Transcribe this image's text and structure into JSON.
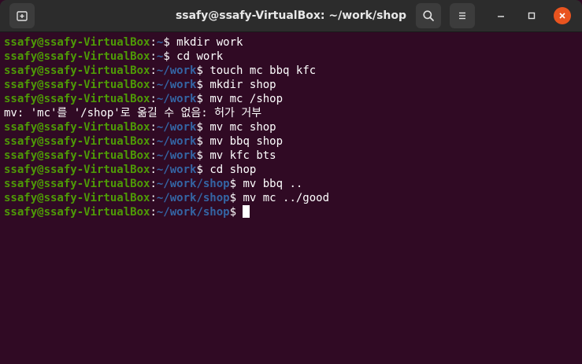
{
  "window": {
    "title": "ssafy@ssafy-VirtualBox: ~/work/shop"
  },
  "icons": {
    "new_tab": "new-tab-icon",
    "search": "search-icon",
    "menu": "hamburger-menu-icon",
    "minimize": "minimize-icon",
    "maximize": "maximize-icon",
    "close": "close-icon"
  },
  "colors": {
    "background": "#300a24",
    "user_host": "#4e9a06",
    "path": "#3465a4",
    "text": "#ffffff",
    "close_button": "#e9541f"
  },
  "terminal": {
    "lines": [
      {
        "user": "ssafy@ssafy-VirtualBox",
        "sep1": ":",
        "path": "~",
        "sep2": "$ ",
        "cmd": "mkdir work"
      },
      {
        "user": "ssafy@ssafy-VirtualBox",
        "sep1": ":",
        "path": "~",
        "sep2": "$ ",
        "cmd": "cd work"
      },
      {
        "user": "ssafy@ssafy-VirtualBox",
        "sep1": ":",
        "path": "~/work",
        "sep2": "$ ",
        "cmd": "touch mc bbq kfc"
      },
      {
        "user": "ssafy@ssafy-VirtualBox",
        "sep1": ":",
        "path": "~/work",
        "sep2": "$ ",
        "cmd": "mkdir shop"
      },
      {
        "user": "ssafy@ssafy-VirtualBox",
        "sep1": ":",
        "path": "~/work",
        "sep2": "$ ",
        "cmd": "mv mc /shop"
      },
      {
        "output": "mv: 'mc'를 '/shop'로 옮길 수 없음: 허가 거부"
      },
      {
        "user": "ssafy@ssafy-VirtualBox",
        "sep1": ":",
        "path": "~/work",
        "sep2": "$ ",
        "cmd": "mv mc shop"
      },
      {
        "user": "ssafy@ssafy-VirtualBox",
        "sep1": ":",
        "path": "~/work",
        "sep2": "$ ",
        "cmd": "mv bbq shop"
      },
      {
        "user": "ssafy@ssafy-VirtualBox",
        "sep1": ":",
        "path": "~/work",
        "sep2": "$ ",
        "cmd": "mv kfc bts"
      },
      {
        "user": "ssafy@ssafy-VirtualBox",
        "sep1": ":",
        "path": "~/work",
        "sep2": "$ ",
        "cmd": "cd shop"
      },
      {
        "user": "ssafy@ssafy-VirtualBox",
        "sep1": ":",
        "path": "~/work/shop",
        "sep2": "$ ",
        "cmd": "mv bbq .."
      },
      {
        "user": "ssafy@ssafy-VirtualBox",
        "sep1": ":",
        "path": "~/work/shop",
        "sep2": "$ ",
        "cmd": "mv mc ../good"
      },
      {
        "user": "ssafy@ssafy-VirtualBox",
        "sep1": ":",
        "path": "~/work/shop",
        "sep2": "$ ",
        "cmd": ""
      }
    ]
  }
}
